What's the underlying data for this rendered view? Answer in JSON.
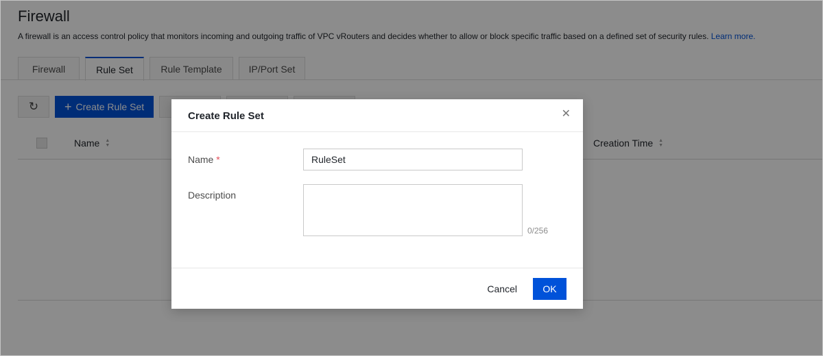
{
  "page": {
    "title": "Firewall",
    "description": "A firewall is an access control policy that monitors incoming and outgoing traffic of VPC vRouters and decides whether to allow or block specific traffic based on a defined set of security rules.",
    "learn_more": "Learn more."
  },
  "tabs": [
    {
      "label": "Firewall",
      "active": false
    },
    {
      "label": "Rule Set",
      "active": true
    },
    {
      "label": "Rule Template",
      "active": false
    },
    {
      "label": "IP/Port Set",
      "active": false
    }
  ],
  "toolbar": {
    "refresh_icon": "refresh-icon",
    "create_label": "Create Rule Set",
    "create_icon": "plus-icon"
  },
  "table": {
    "columns": [
      "Name",
      "Creation Time"
    ]
  },
  "modal": {
    "title": "Create Rule Set",
    "close_icon": "close-icon",
    "name_label": "Name",
    "required_mark": "*",
    "name_value": "RuleSet",
    "description_label": "Description",
    "description_value": "",
    "counter": "0/256",
    "cancel_label": "Cancel",
    "ok_label": "OK"
  },
  "colors": {
    "accent": "#0052d9",
    "required": "#e34d59",
    "overlay": "rgba(0,0,0,0.45)"
  }
}
